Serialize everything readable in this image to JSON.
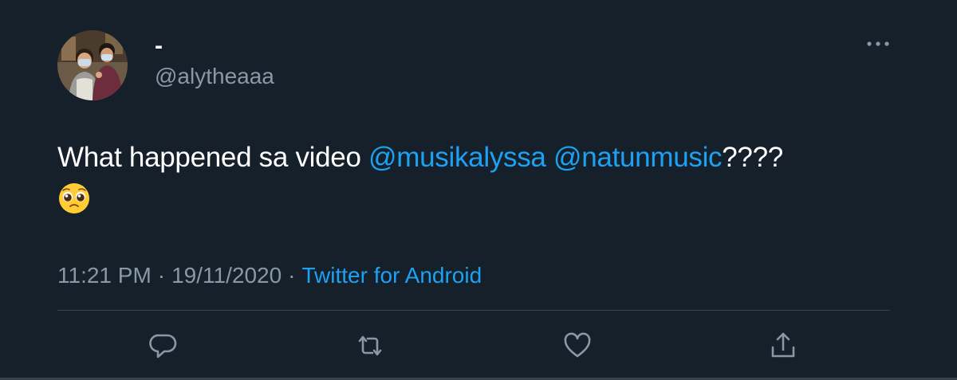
{
  "user": {
    "display_name": "-",
    "handle": "@alytheaaa"
  },
  "tweet": {
    "text_before": "What happened sa video ",
    "mention_1": "@musikalyssa",
    "between": " ",
    "mention_2": "@natunmusic",
    "text_after": "????",
    "emoji_name": "pleading-face-emoji"
  },
  "meta": {
    "time": "11:21 PM",
    "separator_1": "·",
    "date": "19/11/2020",
    "separator_2": "·",
    "source": "Twitter for Android"
  },
  "actions": {
    "reply_icon": "reply-icon",
    "retweet_icon": "retweet-icon",
    "like_icon": "heart-icon",
    "share_icon": "share-icon",
    "more_icon": "more-icon"
  },
  "colors": {
    "background": "#15202b",
    "accent": "#1da1f2",
    "secondary_text": "#8899a6",
    "divider": "#38444d"
  }
}
